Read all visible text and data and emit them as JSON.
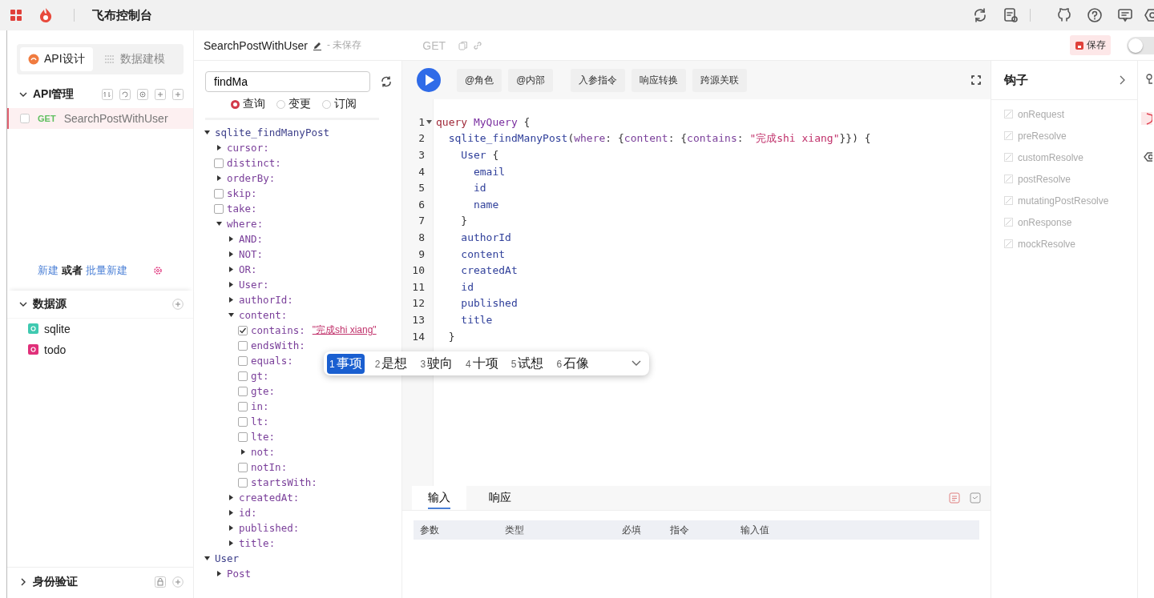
{
  "topbar": {
    "title": "飞布控制台"
  },
  "sidebar": {
    "tabs": [
      {
        "label": "API设计",
        "selected": true
      },
      {
        "label": "数据建模",
        "selected": false
      }
    ],
    "api_section": {
      "title": "API管理",
      "expanded": true,
      "items": [
        {
          "method": "GET",
          "name": "SearchPostWithUser",
          "selected": true
        }
      ]
    },
    "create_links": {
      "new": "新建",
      "or": "或者",
      "batch": "批量新建"
    },
    "datasource_section": {
      "title": "数据源",
      "expanded": true,
      "items": [
        {
          "name": "sqlite",
          "color": "#3fc9b0"
        },
        {
          "name": "todo",
          "color": "#e0307a"
        }
      ]
    },
    "auth_section": {
      "title": "身份验证",
      "expanded": false
    }
  },
  "header": {
    "name": "SearchPostWithUser",
    "status": "- 未保存",
    "method": "GET",
    "save": "保存",
    "toggle": {
      "on": false
    }
  },
  "explorer": {
    "search": {
      "value": "findMa"
    },
    "operations": [
      {
        "label": "查询",
        "selected": true
      },
      {
        "label": "变更",
        "selected": false
      },
      {
        "label": "订阅",
        "selected": false
      }
    ],
    "tree": [
      {
        "label": "sqlite_findManyPost",
        "kind": "toggle",
        "expanded": true,
        "children": [
          {
            "label": "cursor:",
            "kind": "toggle",
            "expanded": false
          },
          {
            "label": "distinct:",
            "kind": "checkbox",
            "checked": false
          },
          {
            "label": "orderBy:",
            "kind": "toggle",
            "expanded": false
          },
          {
            "label": "skip:",
            "kind": "checkbox",
            "checked": false
          },
          {
            "label": "take:",
            "kind": "checkbox",
            "checked": false
          },
          {
            "label": "where:",
            "kind": "toggle",
            "expanded": true,
            "children": [
              {
                "label": "AND:",
                "kind": "toggle",
                "expanded": false
              },
              {
                "label": "NOT:",
                "kind": "toggle",
                "expanded": false
              },
              {
                "label": "OR:",
                "kind": "toggle",
                "expanded": false
              },
              {
                "label": "User:",
                "kind": "toggle",
                "expanded": false
              },
              {
                "label": "authorId:",
                "kind": "toggle",
                "expanded": false
              },
              {
                "label": "content:",
                "kind": "toggle",
                "expanded": true,
                "children": [
                  {
                    "label": "contains:",
                    "kind": "checkbox",
                    "checked": true,
                    "value": "\"完成shi xiang\""
                  },
                  {
                    "label": "endsWith:",
                    "kind": "checkbox",
                    "checked": false
                  },
                  {
                    "label": "equals:",
                    "kind": "checkbox",
                    "checked": false
                  },
                  {
                    "label": "gt:",
                    "kind": "checkbox",
                    "checked": false
                  },
                  {
                    "label": "gte:",
                    "kind": "checkbox",
                    "checked": false
                  },
                  {
                    "label": "in:",
                    "kind": "checkbox",
                    "checked": false
                  },
                  {
                    "label": "lt:",
                    "kind": "checkbox",
                    "checked": false
                  },
                  {
                    "label": "lte:",
                    "kind": "checkbox",
                    "checked": false
                  },
                  {
                    "label": "not:",
                    "kind": "toggle",
                    "expanded": false
                  },
                  {
                    "label": "notIn:",
                    "kind": "checkbox",
                    "checked": false
                  },
                  {
                    "label": "startsWith:",
                    "kind": "checkbox",
                    "checked": false
                  }
                ]
              },
              {
                "label": "createdAt:",
                "kind": "toggle",
                "expanded": false
              },
              {
                "label": "id:",
                "kind": "toggle",
                "expanded": false
              },
              {
                "label": "published:",
                "kind": "toggle",
                "expanded": false
              },
              {
                "label": "title:",
                "kind": "toggle",
                "expanded": false
              }
            ]
          }
        ]
      },
      {
        "label": "User",
        "kind": "toggle",
        "expanded": true,
        "children": [
          {
            "label": "Post",
            "kind": "toggle",
            "expanded": false
          }
        ]
      }
    ]
  },
  "toolbar": {
    "buttons": [
      "@角色",
      "@内部",
      "入参指令",
      "响应转换",
      "跨源关联"
    ]
  },
  "editor": {
    "lines": [
      {
        "number": "1",
        "foldable": true,
        "tokens": [
          {
            "text": "query ",
            "kind": "keyword"
          },
          {
            "text": "MyQuery",
            "kind": "def"
          },
          {
            "text": " {",
            "kind": "plain"
          }
        ]
      },
      {
        "number": "2",
        "foldable": false,
        "tokens": [
          {
            "text": "  sqlite_findManyPost",
            "kind": "field"
          },
          {
            "text": "(",
            "kind": "plain"
          },
          {
            "text": "where",
            "kind": "arg"
          },
          {
            "text": ": {",
            "kind": "plain"
          },
          {
            "text": "content",
            "kind": "arg"
          },
          {
            "text": ": {",
            "kind": "plain"
          },
          {
            "text": "contains",
            "kind": "arg"
          },
          {
            "text": ": ",
            "kind": "plain"
          },
          {
            "text": "\"完成shi xiang\"",
            "kind": "string"
          },
          {
            "text": "}}) {",
            "kind": "plain"
          }
        ]
      },
      {
        "number": "3",
        "foldable": false,
        "tokens": [
          {
            "text": "    User",
            "kind": "field"
          },
          {
            "text": " {",
            "kind": "plain"
          }
        ]
      },
      {
        "number": "4",
        "foldable": false,
        "tokens": [
          {
            "text": "      email",
            "kind": "field"
          }
        ]
      },
      {
        "number": "5",
        "foldable": false,
        "tokens": [
          {
            "text": "      id",
            "kind": "field"
          }
        ]
      },
      {
        "number": "6",
        "foldable": false,
        "tokens": [
          {
            "text": "      name",
            "kind": "field"
          }
        ]
      },
      {
        "number": "7",
        "foldable": false,
        "tokens": [
          {
            "text": "    }",
            "kind": "plain"
          }
        ]
      },
      {
        "number": "8",
        "foldable": false,
        "tokens": [
          {
            "text": "    authorId",
            "kind": "field"
          }
        ]
      },
      {
        "number": "9",
        "foldable": false,
        "tokens": [
          {
            "text": "    content",
            "kind": "field"
          }
        ]
      },
      {
        "number": "10",
        "foldable": false,
        "tokens": [
          {
            "text": "    createdAt",
            "kind": "field"
          }
        ]
      },
      {
        "number": "11",
        "foldable": false,
        "tokens": [
          {
            "text": "    id",
            "kind": "field"
          }
        ]
      },
      {
        "number": "12",
        "foldable": false,
        "tokens": [
          {
            "text": "    published",
            "kind": "field"
          }
        ]
      },
      {
        "number": "13",
        "foldable": false,
        "tokens": [
          {
            "text": "    title",
            "kind": "field"
          }
        ]
      },
      {
        "number": "14",
        "foldable": false,
        "tokens": [
          {
            "text": "  }",
            "kind": "plain"
          }
        ]
      }
    ],
    "candidates": [
      {
        "index": "1",
        "word": "事项",
        "selected": true
      },
      {
        "index": "2",
        "word": "是想",
        "selected": false
      },
      {
        "index": "3",
        "word": "驶向",
        "selected": false
      },
      {
        "index": "4",
        "word": "十项",
        "selected": false
      },
      {
        "index": "5",
        "word": "试想",
        "selected": false
      },
      {
        "index": "6",
        "word": "石像",
        "selected": false
      }
    ]
  },
  "bottom_panel": {
    "tabs": [
      {
        "label": "输入",
        "selected": true
      },
      {
        "label": "响应",
        "selected": false
      }
    ],
    "columns": [
      "参数",
      "类型",
      "必填",
      "指令",
      "输入值"
    ]
  },
  "hooks": {
    "title": "钩子",
    "items": [
      {
        "name": "onRequest",
        "enabled": false
      },
      {
        "name": "preResolve",
        "enabled": false
      },
      {
        "name": "customResolve",
        "enabled": false
      },
      {
        "name": "postResolve",
        "enabled": false
      },
      {
        "name": "mutatingPostResolve",
        "enabled": false
      },
      {
        "name": "onResponse",
        "enabled": false
      },
      {
        "name": "mockResolve",
        "enabled": false
      }
    ]
  }
}
